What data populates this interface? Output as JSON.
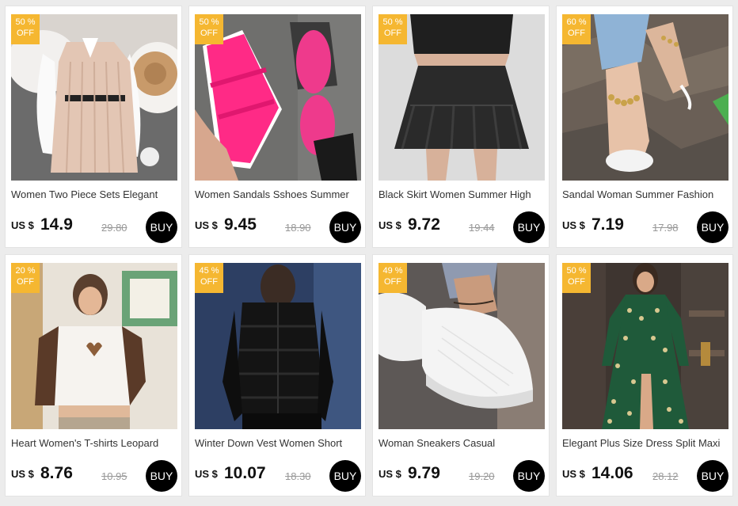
{
  "products": [
    {
      "badge_pct": "50 %",
      "badge_off": "OFF",
      "title": "Women Two Piece Sets Elegant",
      "currency": "US $",
      "price": "14.9",
      "old_price": "29.80",
      "buy_label": "BUY",
      "image": "knit-vest-dress-photo"
    },
    {
      "badge_pct": "50 %",
      "badge_off": "OFF",
      "title": "Women Sandals Sshoes Summer",
      "currency": "US $",
      "price": "9.45",
      "old_price": "18.90",
      "buy_label": "BUY",
      "image": "pink-sandals-photo"
    },
    {
      "badge_pct": "50 %",
      "badge_off": "OFF",
      "title": "Black Skirt Women Summer High",
      "currency": "US $",
      "price": "9.72",
      "old_price": "19.44",
      "buy_label": "BUY",
      "image": "black-skirt-photo"
    },
    {
      "badge_pct": "60 %",
      "badge_off": "OFF",
      "title": "Sandal Woman Summer Fashion",
      "currency": "US $",
      "price": "7.19",
      "old_price": "17.98",
      "buy_label": "BUY",
      "image": "chain-sandal-photo"
    },
    {
      "badge_pct": "20 %",
      "badge_off": "OFF",
      "title": "Heart Women's T-shirts Leopard",
      "currency": "US $",
      "price": "8.76",
      "old_price": "10.95",
      "buy_label": "BUY",
      "image": "raglan-tshirt-photo"
    },
    {
      "badge_pct": "45 %",
      "badge_off": "OFF",
      "title": "Winter Down Vest Women Short",
      "currency": "US $",
      "price": "10.07",
      "old_price": "18.30",
      "buy_label": "BUY",
      "image": "down-vest-photo"
    },
    {
      "badge_pct": "49 %",
      "badge_off": "OFF",
      "title": "Woman Sneakers Casual",
      "currency": "US $",
      "price": "9.79",
      "old_price": "19.20",
      "buy_label": "BUY",
      "image": "white-sneakers-photo"
    },
    {
      "badge_pct": "50 %",
      "badge_off": "OFF",
      "title": "Elegant Plus Size Dress Split Maxi",
      "currency": "US $",
      "price": "14.06",
      "old_price": "28.12",
      "buy_label": "BUY",
      "image": "green-polka-dress-photo"
    }
  ]
}
